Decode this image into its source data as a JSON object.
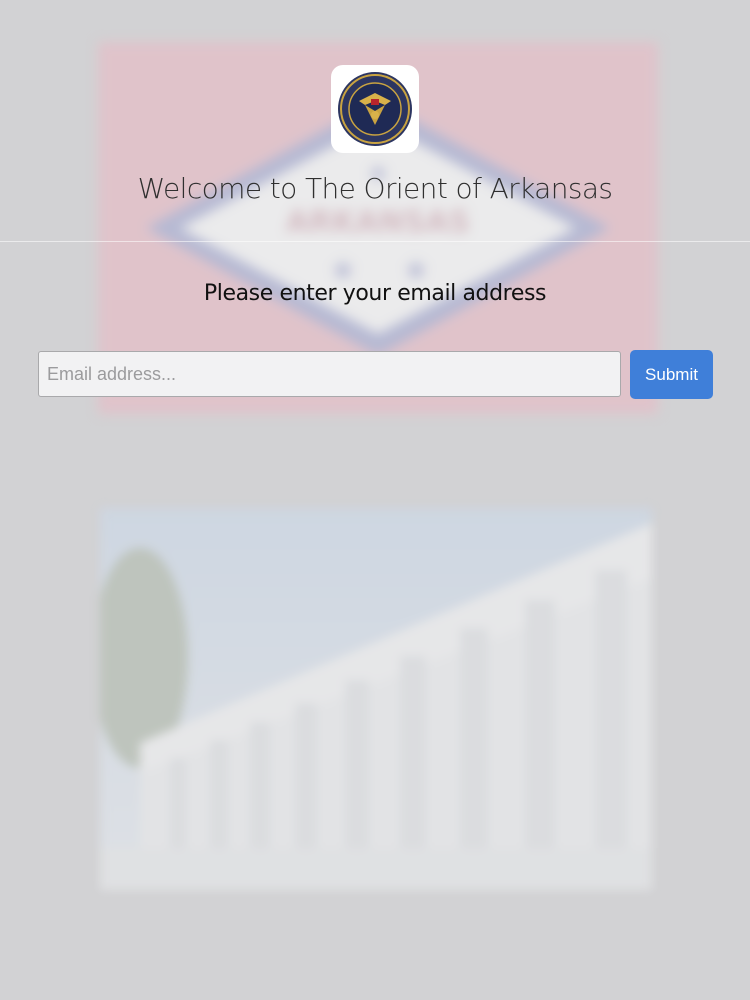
{
  "header": {
    "title": "Welcome to The Orient of Arkansas",
    "logo_icon": "scottish-rite-seal-icon"
  },
  "form": {
    "prompt": "Please enter your email address",
    "email_placeholder": "Email address...",
    "email_value": "",
    "submit_label": "Submit"
  },
  "background": {
    "flag_text": "ARKANSAS"
  },
  "colors": {
    "page_background": "#cfcfd1",
    "accent": "#3f7fd9",
    "flag_red": "#e7a7b5",
    "flag_blue": "#9aa0cf"
  }
}
